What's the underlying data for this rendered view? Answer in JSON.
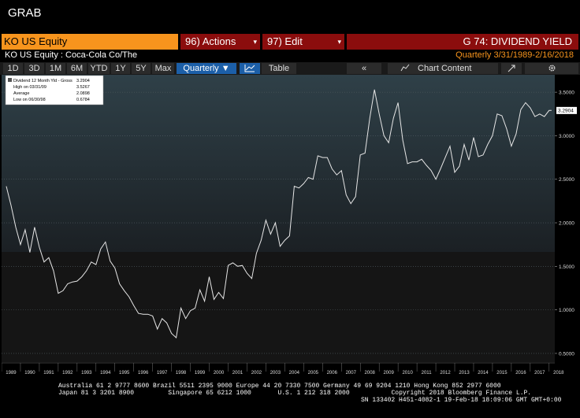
{
  "window": {
    "title": "GRAB"
  },
  "command_bar": {
    "ticker": "KO US Equity",
    "actions": {
      "num": "96)",
      "label": " Actions"
    },
    "edit": {
      "num": "97)",
      "label": " Edit"
    },
    "function_title": "G 74: DIVIDEND YIELD"
  },
  "sub_bar": {
    "security": "KO US Equity : Coca-Cola Co/The",
    "period": "Quarterly   3/31/1989-2/16/2018"
  },
  "toolbar": {
    "ranges": [
      "1D",
      "3D",
      "1M",
      "6M",
      "YTD",
      "1Y",
      "5Y",
      "Max"
    ],
    "frequency": "Quarterly ▼",
    "table_label": "Table",
    "back_label": "«",
    "chart_content_label": "Chart Content"
  },
  "legend": {
    "series": "Dividend 12 Month Yld - Gross",
    "last": "3.2904",
    "high_label": "High on 03/31/09",
    "high": "3.5267",
    "avg_label": "Average",
    "avg": "2.0898",
    "low_label": "Low on 06/30/98",
    "low": "0.6784"
  },
  "chart_data": {
    "type": "line",
    "ylim": [
      0.4,
      3.7
    ],
    "yticks": [
      "0.5000",
      "1.0000",
      "1.5000",
      "2.0000",
      "2.5000",
      "3.0000",
      "3.5000"
    ],
    "ytick_values": [
      0.5,
      1.0,
      1.5,
      2.0,
      2.5,
      3.0,
      3.5
    ],
    "xticks": [
      "1989",
      "1990",
      "1991",
      "1992",
      "1993",
      "1994",
      "1995",
      "1996",
      "1997",
      "1998",
      "1999",
      "2000",
      "2001",
      "2002",
      "2003",
      "2004",
      "2005",
      "2006",
      "2007",
      "2008",
      "2009",
      "2010",
      "2011",
      "2012",
      "2013",
      "2014",
      "2015",
      "2016",
      "2017",
      "2018"
    ],
    "last_value_label": "3.2904",
    "series": [
      {
        "name": "Dividend 12 Month Yld - Gross",
        "color": "#e6e6e6",
        "x": [
          1989.25,
          1989.5,
          1989.75,
          1990.0,
          1990.25,
          1990.5,
          1990.75,
          1991.0,
          1991.25,
          1991.5,
          1991.75,
          1992.0,
          1992.25,
          1992.5,
          1992.75,
          1993.0,
          1993.25,
          1993.5,
          1993.75,
          1994.0,
          1994.25,
          1994.5,
          1994.75,
          1995.0,
          1995.25,
          1995.5,
          1995.75,
          1996.0,
          1996.25,
          1996.5,
          1996.75,
          1997.0,
          1997.25,
          1997.5,
          1997.75,
          1998.0,
          1998.25,
          1998.5,
          1998.75,
          1999.0,
          1999.25,
          1999.5,
          1999.75,
          2000.0,
          2000.25,
          2000.5,
          2000.75,
          2001.0,
          2001.25,
          2001.5,
          2001.75,
          2002.0,
          2002.25,
          2002.5,
          2002.75,
          2003.0,
          2003.25,
          2003.5,
          2003.75,
          2004.0,
          2004.25,
          2004.5,
          2004.75,
          2005.0,
          2005.25,
          2005.5,
          2005.75,
          2006.0,
          2006.25,
          2006.5,
          2006.75,
          2007.0,
          2007.25,
          2007.5,
          2007.75,
          2008.0,
          2008.25,
          2008.5,
          2008.75,
          2009.0,
          2009.25,
          2009.5,
          2009.75,
          2010.0,
          2010.25,
          2010.5,
          2010.75,
          2011.0,
          2011.25,
          2011.5,
          2011.75,
          2012.0,
          2012.25,
          2012.5,
          2012.75,
          2013.0,
          2013.25,
          2013.5,
          2013.75,
          2014.0,
          2014.25,
          2014.5,
          2014.75,
          2015.0,
          2015.25,
          2015.5,
          2015.75,
          2016.0,
          2016.25,
          2016.5,
          2016.75,
          2017.0,
          2017.25,
          2017.5,
          2017.75,
          2018.0,
          2018.13
        ],
        "values": [
          2.42,
          2.2,
          1.95,
          1.75,
          1.92,
          1.66,
          1.95,
          1.72,
          1.55,
          1.6,
          1.45,
          1.19,
          1.22,
          1.3,
          1.32,
          1.33,
          1.38,
          1.45,
          1.55,
          1.52,
          1.7,
          1.78,
          1.56,
          1.48,
          1.3,
          1.22,
          1.15,
          1.05,
          0.96,
          0.95,
          0.95,
          0.93,
          0.78,
          0.9,
          0.85,
          0.73,
          0.68,
          1.02,
          0.9,
          0.99,
          1.02,
          1.23,
          1.1,
          1.38,
          1.12,
          1.2,
          1.13,
          1.51,
          1.54,
          1.5,
          1.51,
          1.42,
          1.36,
          1.65,
          1.8,
          2.03,
          1.87,
          2.0,
          1.73,
          1.8,
          1.85,
          2.42,
          2.4,
          2.45,
          2.52,
          2.5,
          2.77,
          2.75,
          2.75,
          2.62,
          2.55,
          2.6,
          2.32,
          2.22,
          2.3,
          2.78,
          2.8,
          3.2,
          3.53,
          3.25,
          3.0,
          2.92,
          3.2,
          3.38,
          2.95,
          2.68,
          2.7,
          2.7,
          2.73,
          2.66,
          2.6,
          2.5,
          2.62,
          2.75,
          2.88,
          2.58,
          2.65,
          2.9,
          2.72,
          2.98,
          2.76,
          2.78,
          2.9,
          3.0,
          3.25,
          3.23,
          3.08,
          2.88,
          3.02,
          3.3,
          3.38,
          3.32,
          3.22,
          3.25,
          3.22,
          3.29,
          3.29
        ]
      }
    ]
  },
  "footer": {
    "line1": "Australia 61 2 9777 8600 Brazil 5511 2395 9000 Europe 44 20 7330 7500 Germany 49 69 9204 1210 Hong Kong 852 2977 6000",
    "line2": "Japan 81 3 3201 8900         Singapore 65 6212 1000       U.S. 1 212 318 2000           Copyright 2018 Bloomberg Finance L.P.",
    "line3": "SN 133402 H451-4082-1 19-Feb-18 18:09:06 GMT GMT+0:00"
  }
}
